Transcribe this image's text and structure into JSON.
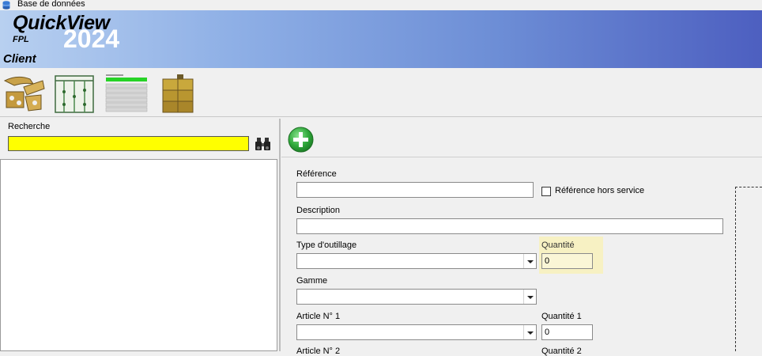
{
  "window": {
    "title": "Base de données",
    "icon": "database-icon"
  },
  "banner": {
    "app_name": "QuickView",
    "vendor": "FPL",
    "year": "2024",
    "module": "Client"
  },
  "toolbar": {
    "tools": [
      {
        "name": "outillage-tool",
        "icon": "tooling-parts-icon"
      },
      {
        "name": "frame-tool",
        "icon": "frame-rack-icon"
      },
      {
        "name": "program-tool",
        "icon": "program-list-icon"
      },
      {
        "name": "stock-tool",
        "icon": "stacked-boxes-icon"
      }
    ]
  },
  "search": {
    "label": "Recherche",
    "value": "",
    "icon": "binoculars-icon"
  },
  "form": {
    "add_icon": "add-circle-icon",
    "reference_label": "Référence",
    "reference_value": "",
    "reference_hs_label": "Référence hors service",
    "reference_hs_checked": false,
    "description_label": "Description",
    "description_value": "",
    "type_label": "Type d'outillage",
    "type_value": "",
    "quantite_label": "Quantité",
    "quantite_value": "0",
    "gamme_label": "Gamme",
    "gamme_value": "",
    "article1_label": "Article N° 1",
    "article1_value": "",
    "quantite1_label": "Quantité 1",
    "quantite1_value": "0",
    "article2_label": "Article N° 2",
    "quantite2_label": "Quantité 2"
  },
  "colors": {
    "search_bg": "#ffff00",
    "quantity_highlight": "#f7f1c3",
    "add_green": "#2fa83a"
  }
}
